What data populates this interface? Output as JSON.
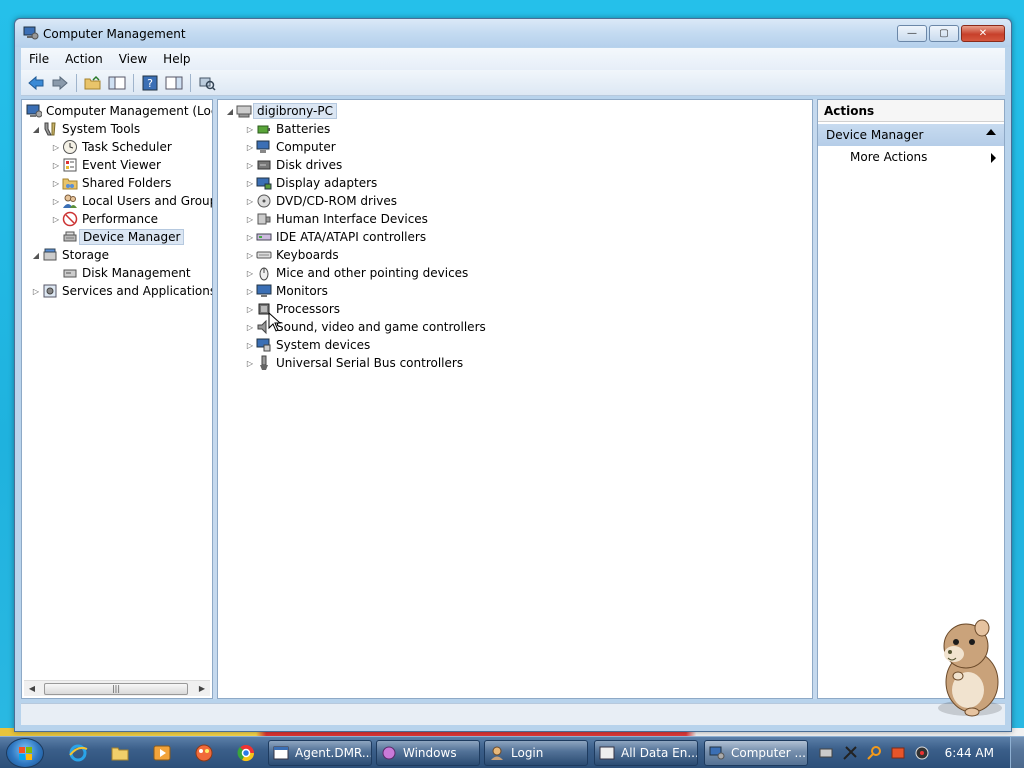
{
  "window": {
    "title": "Computer Management",
    "minimize": "—",
    "maximize": "▢",
    "close": "✕"
  },
  "menu": [
    "File",
    "Action",
    "View",
    "Help"
  ],
  "left_tree": {
    "root": "Computer Management (Local",
    "system_tools": "System Tools",
    "task_scheduler": "Task Scheduler",
    "event_viewer": "Event Viewer",
    "shared_folders": "Shared Folders",
    "local_users": "Local Users and Groups",
    "performance": "Performance",
    "device_manager": "Device Manager",
    "storage": "Storage",
    "disk_management": "Disk Management",
    "services": "Services and Applications",
    "scroll_thumb": "|||"
  },
  "device_tree": {
    "root": "digibrony-PC",
    "items": [
      "Batteries",
      "Computer",
      "Disk drives",
      "Display adapters",
      "DVD/CD-ROM drives",
      "Human Interface Devices",
      "IDE ATA/ATAPI controllers",
      "Keyboards",
      "Mice and other pointing devices",
      "Monitors",
      "Processors",
      "Sound, video and game controllers",
      "System devices",
      "Universal Serial Bus controllers"
    ]
  },
  "actions": {
    "header": "Actions",
    "section": "Device Manager",
    "more": "More Actions"
  },
  "taskbar": {
    "tasks": [
      "Agent.DMR...",
      "Windows",
      "Login",
      "All Data En...",
      "Computer ..."
    ],
    "clock": "6:44 AM"
  }
}
